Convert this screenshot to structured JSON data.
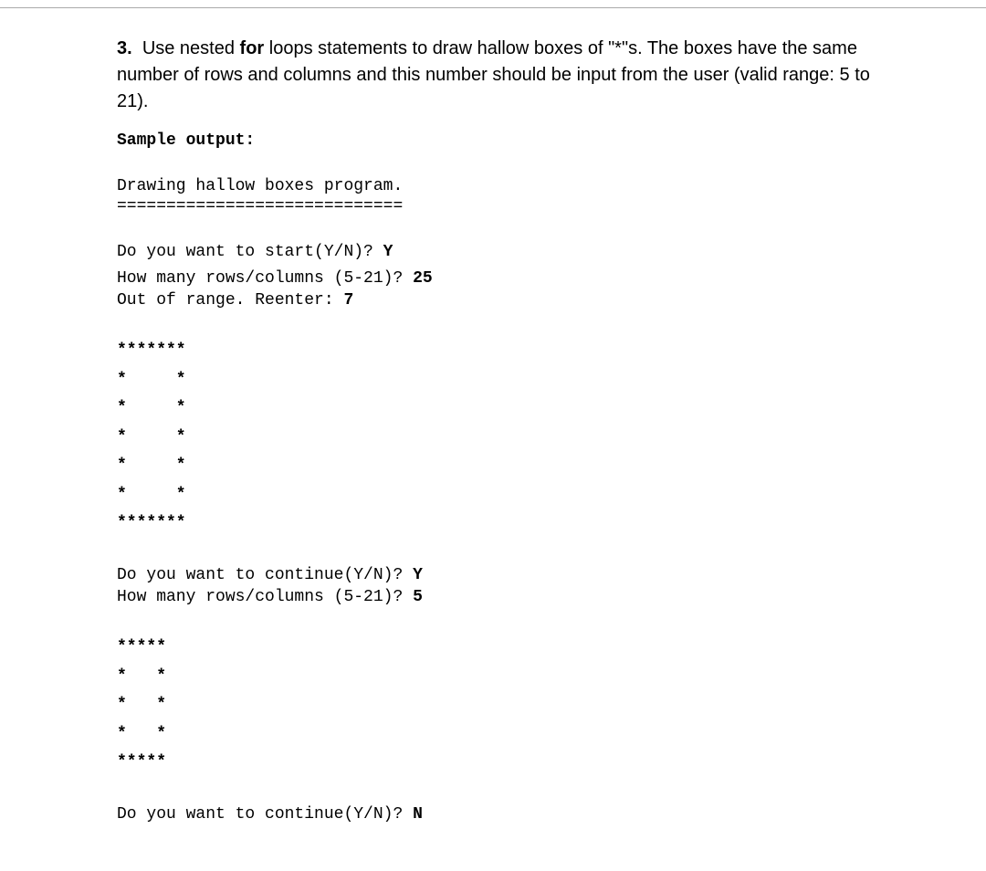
{
  "question": {
    "number": "3.",
    "text_before_for": "Use nested ",
    "for_word": "for",
    "text_after_for": " loops statements to draw hallow boxes of \"*\"s. The boxes have the same number of rows and columns and this number should be input from the user (valid range: 5 to 21)."
  },
  "sample_output_label": "Sample output:",
  "program_intro": {
    "title": "Drawing hallow boxes program.",
    "divider": "============================="
  },
  "interaction1": {
    "start_prompt": "Do you want to start(Y/N)? ",
    "start_answer": "Y",
    "size_prompt": "How many rows/columns (5-21)? ",
    "size_answer": "25",
    "reenter_prompt": "Out of range. Reenter: ",
    "reenter_answer": "7"
  },
  "box1": {
    "line1": "*******",
    "line2": "*     *",
    "line3": "*     *",
    "line4": "*     *",
    "line5": "*     *",
    "line6": "*     *",
    "line7": "*******"
  },
  "interaction2": {
    "continue_prompt": "Do you want to continue(Y/N)? ",
    "continue_answer": "Y",
    "size_prompt": "How many rows/columns (5-21)? ",
    "size_answer": "5"
  },
  "box2": {
    "line1": "*****",
    "line2": "*   *",
    "line3": "*   *",
    "line4": "*   *",
    "line5": "*****"
  },
  "interaction3": {
    "continue_prompt": "Do you want to continue(Y/N)? ",
    "continue_answer": "N"
  }
}
